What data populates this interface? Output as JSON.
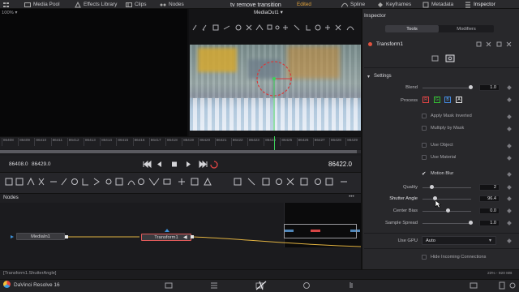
{
  "topbar": {
    "media_pool": "Media Pool",
    "effects_library": "Effects Library",
    "clips": "Clips",
    "nodes": "Nodes",
    "project_title": "tv remove transition",
    "edited_badge": "Edited",
    "spline": "Spline",
    "keyframes": "Keyframes",
    "metadata": "Metadata",
    "inspector": "Inspector"
  },
  "viewer": {
    "zoom": "100%",
    "name": "MediaOut1"
  },
  "timeline": {
    "ticks": [
      "86408",
      "86409",
      "86410",
      "86411",
      "86412",
      "86413",
      "86414",
      "86415",
      "86416",
      "86417",
      "86418",
      "86419",
      "86420",
      "86421",
      "86422",
      "86423",
      "86424",
      "86425",
      "86426",
      "86427",
      "86428",
      "86429"
    ],
    "start_frame": "86408.0",
    "end_frame": "86429.0",
    "current_frame": "86422.0"
  },
  "nodes_panel": {
    "title": "Nodes",
    "more": "•••",
    "media_in": "MediaIn1",
    "transform": "Transform1"
  },
  "inspector": {
    "title": "Inspector",
    "tabs": [
      "Tools",
      "Modifiers"
    ],
    "node_name": "Transform1",
    "settings_label": "Settings",
    "blend_label": "Blend",
    "blend_value": "1.0",
    "process_label": "Process",
    "process_channels": [
      "R",
      "G",
      "B",
      "A"
    ],
    "apply_mask_inverted": "Apply Mask Inverted",
    "multiply_by_mask": "Multiply by Mask",
    "use_object": "Use Object",
    "use_material": "Use Material",
    "motion_blur": "Motion Blur",
    "quality_label": "Quality",
    "quality_value": "2",
    "shutter_angle_label": "Shutter Angle",
    "shutter_angle_value": "96.4",
    "center_bias_label": "Center Bias",
    "center_bias_value": "0.0",
    "sample_spread_label": "Sample Spread",
    "sample_spread_value": "1.0",
    "use_gpu_label": "Use GPU",
    "use_gpu_value": "Auto",
    "hide_incoming": "Hide Incoming Connections"
  },
  "statusbar": {
    "path": "[Transform1.ShutterAngle]",
    "app_name": "DaVinci Resolve 16",
    "usage": "23% - 920 MB"
  },
  "colors": {
    "accent_red": "#e06a6a",
    "edited_orange": "#e2a33b",
    "spline_green": "#3fb35f"
  }
}
